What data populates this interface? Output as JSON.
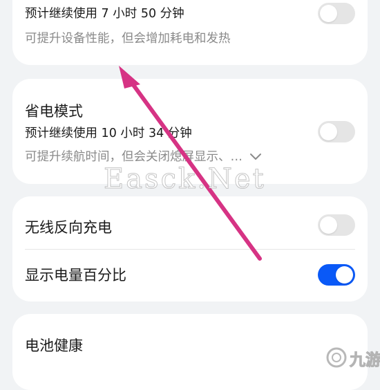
{
  "performance_card": {
    "subtitle": "预计继续使用 7 小时 50 分钟",
    "description": "可提升设备性能，但会增加耗电和发热",
    "toggle_on": false
  },
  "power_saving_card": {
    "title": "省电模式",
    "subtitle": "预计继续使用 10 小时 34 分钟",
    "description": "可提升续航时间，但会关闭熄屏显示、…",
    "toggle_on": false
  },
  "options_card": {
    "wireless_reverse_charging": {
      "label": "无线反向充电",
      "toggle_on": false
    },
    "battery_percentage": {
      "label": "显示电量百分比",
      "toggle_on": true
    }
  },
  "battery_health_card": {
    "title": "电池健康"
  },
  "overlay": {
    "watermark": "Easck.Net",
    "logo_text": "九游",
    "annotation_arrow_color": "#d63384"
  },
  "colors": {
    "background": "#f1f3f5",
    "card": "#ffffff",
    "toggle_on": "#0a59f7",
    "toggle_off": "#e5e5e5",
    "secondary_text": "#8a8a8a"
  },
  "icons": {
    "expand": "chevron-down-icon"
  }
}
